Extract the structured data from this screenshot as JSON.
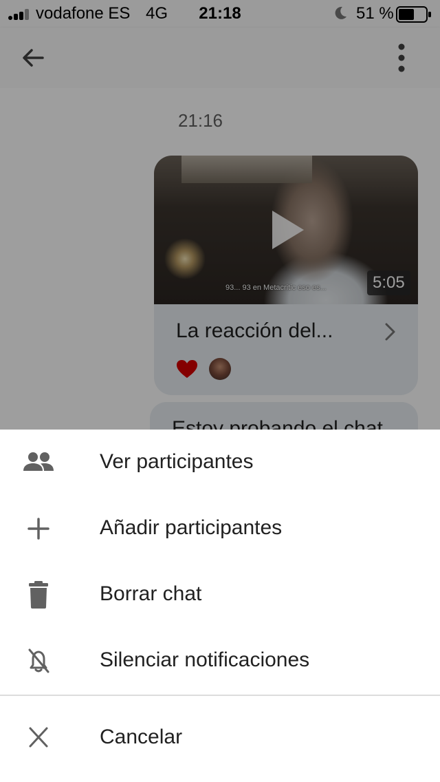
{
  "status_bar": {
    "carrier": "vodafone ES",
    "network": "4G",
    "time": "21:18",
    "battery_percent": "51 %",
    "icons": [
      "signal-icon",
      "moon-icon",
      "battery-icon"
    ]
  },
  "app_bar": {
    "icons": [
      "back-arrow-icon",
      "more-vertical-icon"
    ]
  },
  "chat": {
    "timestamp": "21:16",
    "video_message": {
      "duration": "5:05",
      "subtitle": "93... 93 en Metacritic eso es...",
      "title": "La reacción del...",
      "reaction": "heart-icon"
    },
    "text_message": "Estoy probando el chat"
  },
  "bottom_sheet": {
    "items": [
      {
        "label": "Ver participantes",
        "icon": "people-icon"
      },
      {
        "label": "Añadir participantes",
        "icon": "plus-icon"
      },
      {
        "label": "Borrar chat",
        "icon": "trash-icon"
      },
      {
        "label": "Silenciar notificaciones",
        "icon": "notifications-off-icon"
      }
    ],
    "cancel": {
      "label": "Cancelar",
      "icon": "close-icon"
    }
  },
  "colors": {
    "scrim": "#000000",
    "heart": "#d50000",
    "bubble": "#e9eef2",
    "icon_gray": "#616161"
  }
}
